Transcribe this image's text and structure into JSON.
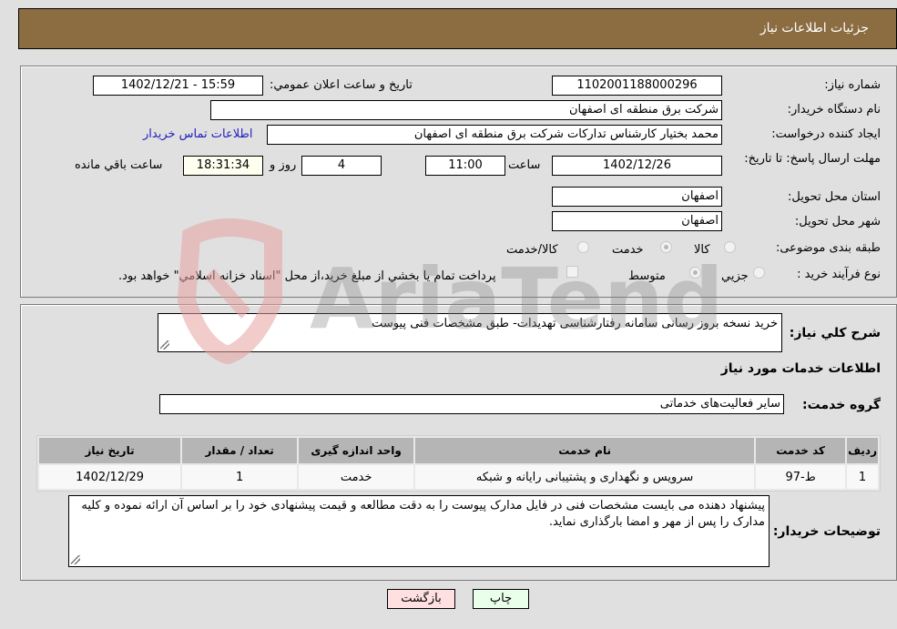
{
  "header": {
    "title": "جزئیات اطلاعات نیاز"
  },
  "fields": {
    "need_number": {
      "label": "شماره نیاز:",
      "value": "1102001188000296"
    },
    "announce": {
      "label": "تاریخ و ساعت اعلان عمومي:",
      "value": "1402/12/21 - 15:59"
    },
    "buyer_org": {
      "label": "نام دستگاه خريدار:",
      "value": "شرکت برق منطقه ای اصفهان"
    },
    "creator": {
      "label": "ايجاد کننده درخواست:",
      "value": "محمد بختیار کارشناس تدارکات شرکت برق منطقه ای اصفهان"
    },
    "buyer_contact_link": "اطلاعات تماس خريدار",
    "deadline": {
      "label": "مهلت ارسال پاسخ: تا تاريخ:",
      "date": "1402/12/26",
      "time_label": "ساعت",
      "time": "11:00",
      "days": "4",
      "days_label": "روز و",
      "remaining": "18:31:34",
      "remaining_label": "ساعت باقي مانده"
    },
    "province": {
      "label": "استان محل تحويل:",
      "value": "اصفهان"
    },
    "city": {
      "label": "شهر محل تحويل:",
      "value": "اصفهان"
    },
    "category": {
      "label": "طبقه بندی موضوعی:",
      "options": [
        "کالا",
        "خدمت",
        "کالا/خدمت"
      ],
      "selected": "خدمت"
    },
    "process": {
      "label": "نوع فرآيند خريد :",
      "options": [
        "جزيي",
        "متوسط"
      ],
      "selected": "متوسط",
      "treasury_note": "پرداخت تمام يا بخشي از مبلغ خريد،از محل \"اسناد خزانه اسلامي\" خواهد بود."
    }
  },
  "description": {
    "label": "شرح كلي نياز:",
    "value": "خريد نسخه بروز رسانی سامانه رفتارشناسی تهديدات- طبق مشخصات فنی پيوست"
  },
  "services_section": {
    "title": "اطلاعات خدمات مورد نياز",
    "group_label": "گروه خدمت:",
    "group_value": "ساير فعاليت‌های خدماتی"
  },
  "table": {
    "headers": [
      "رديف",
      "کد خدمت",
      "نام خدمت",
      "واحد اندازه گيری",
      "تعداد / مقدار",
      "تاريخ نياز"
    ],
    "rows": [
      [
        "1",
        "ط-97",
        "سرويس و نگهداری و پشتيبانی رايانه و شبکه",
        "خدمت",
        "1",
        "1402/12/29"
      ]
    ]
  },
  "buyer_notes": {
    "label": "توضيحات خريدار:",
    "value": "پيشنهاد دهنده می بايست مشخصات فنی در فايل مدارک پيوست را به دقت مطالعه و قيمت پيشنهادی خود را بر اساس آن ارائه نموده و کليه مدارک را پس از مهر و امضا بارگذاری نمايد."
  },
  "buttons": {
    "print": "چاپ",
    "back": "بازگشت"
  },
  "watermark": {
    "text": "AriaTender.net"
  }
}
